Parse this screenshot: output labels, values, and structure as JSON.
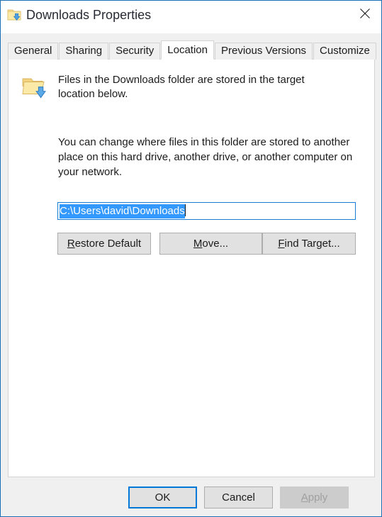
{
  "window": {
    "title": "Downloads Properties",
    "title_icon": "downloads-folder-icon",
    "close_icon": "close-icon",
    "border_color": "#1a6fb5",
    "titlebar_background": "#ffffff",
    "dialog_background": "#f0f0f0"
  },
  "tabs": [
    {
      "label": "General",
      "active": false
    },
    {
      "label": "Sharing",
      "active": false
    },
    {
      "label": "Security",
      "active": false
    },
    {
      "label": "Location",
      "active": true
    },
    {
      "label": "Previous Versions",
      "active": false
    },
    {
      "label": "Customize",
      "active": false
    }
  ],
  "location_tab": {
    "header_icon": "downloads-folder-icon",
    "header_text": "Files in the Downloads folder are stored in the target location below.",
    "description": "You can change where files in this folder are stored to another place on this hard drive, another drive, or another computer on your network.",
    "path_field": {
      "value": "C:\\Users\\david\\Downloads",
      "placeholder": "",
      "selected": true,
      "focused": true,
      "selection_color": "#3399ff",
      "selection_text_color": "#ffffff",
      "focus_border_color": "#1a7fd4"
    },
    "buttons": [
      {
        "accel": "R",
        "rest": "estore Default",
        "name": "restore-default"
      },
      {
        "accel": "M",
        "rest": "ove...",
        "name": "move"
      },
      {
        "accel": "F",
        "rest": "ind Target...",
        "name": "find-target"
      }
    ]
  },
  "footer": {
    "ok_label": "OK",
    "cancel_label": "Cancel",
    "apply_accel": "A",
    "apply_rest": "pply",
    "ok_is_default": true,
    "apply_disabled": true,
    "default_border_color": "#0078d7",
    "disabled_text_color": "#a0a0a0"
  }
}
